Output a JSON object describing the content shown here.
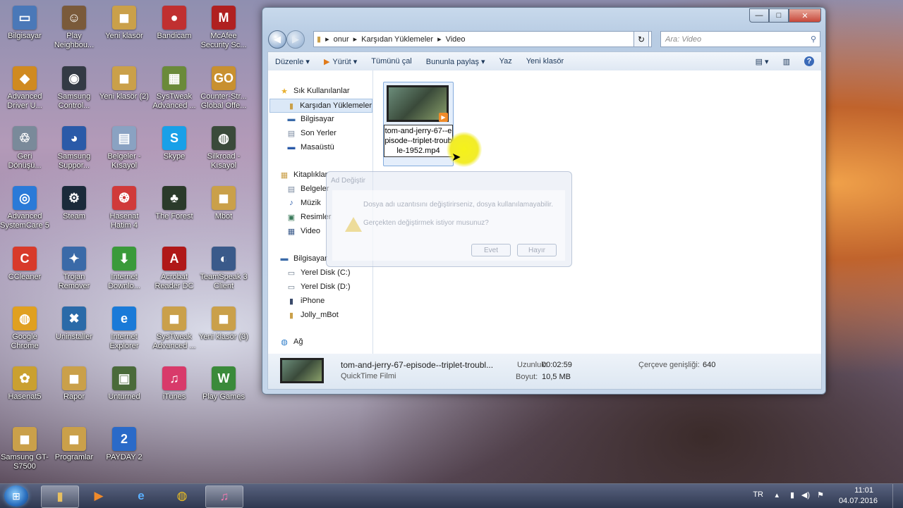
{
  "desktop": {
    "icons": [
      {
        "label": "Bilgisayar",
        "glyph": "▭",
        "color": "#4a78b8"
      },
      {
        "label": "Play Neighbou...",
        "glyph": "☺",
        "color": "#7a5a3a"
      },
      {
        "label": "Yeni klasör",
        "glyph": "◼",
        "color": "#caa04a"
      },
      {
        "label": "Bandicam",
        "glyph": "●",
        "color": "#c03030"
      },
      {
        "label": "McAfee Security Sc...",
        "glyph": "M",
        "color": "#b02020"
      },
      {
        "label": "Advanced Driver U...",
        "glyph": "◆",
        "color": "#d08a20"
      },
      {
        "label": "Samsung Control...",
        "glyph": "◉",
        "color": "#333a44"
      },
      {
        "label": "Yeni klasör (2)",
        "glyph": "◼",
        "color": "#caa04a"
      },
      {
        "label": "SysTweak Advanced ...",
        "glyph": "▦",
        "color": "#6a8a3a"
      },
      {
        "label": "Counter-Str... Global Offe...",
        "glyph": "GO",
        "color": "#c89030"
      },
      {
        "label": "Geri Dönüşü...",
        "glyph": "♲",
        "color": "#7a8a9a"
      },
      {
        "label": "Samsung Suppor...",
        "glyph": "◕",
        "color": "#2a5aa8"
      },
      {
        "label": "Belgeler - Kısayol",
        "glyph": "▤",
        "color": "#8aa2c2"
      },
      {
        "label": "Skype",
        "glyph": "S",
        "color": "#18a0e8"
      },
      {
        "label": "Silkroad - Kısayol",
        "glyph": "◍",
        "color": "#3a4a3a"
      },
      {
        "label": "Advanced SystemCare 5",
        "glyph": "◎",
        "color": "#2a7ad8"
      },
      {
        "label": "Steam",
        "glyph": "⚙",
        "color": "#1a2a3a"
      },
      {
        "label": "Hasenat Hatim 4",
        "glyph": "❂",
        "color": "#d03a3a"
      },
      {
        "label": "The Forest",
        "glyph": "♣",
        "color": "#2a3a2a"
      },
      {
        "label": "Mbot",
        "glyph": "◼",
        "color": "#caa04a"
      },
      {
        "label": "CCleaner",
        "glyph": "C",
        "color": "#d83a2a"
      },
      {
        "label": "Trojan Remover",
        "glyph": "✦",
        "color": "#3a6aa8"
      },
      {
        "label": "Internet Downlo...",
        "glyph": "⬇",
        "color": "#3a9a3a"
      },
      {
        "label": "Acrobat Reader DC",
        "glyph": "A",
        "color": "#b01818"
      },
      {
        "label": "TeamSpeak 3 Client",
        "glyph": "◐",
        "color": "#3a5a8a"
      },
      {
        "label": "Google Chrome",
        "glyph": "◍",
        "color": "#e0a020"
      },
      {
        "label": "Uninstaller",
        "glyph": "✖",
        "color": "#2a6aa8"
      },
      {
        "label": "Internet Explorer",
        "glyph": "e",
        "color": "#1a7ad8"
      },
      {
        "label": "SysTweak Advanced ...",
        "glyph": "◼",
        "color": "#caa04a"
      },
      {
        "label": "Yeni klasör (3)",
        "glyph": "◼",
        "color": "#caa04a"
      },
      {
        "label": "Hasenat5",
        "glyph": "✿",
        "color": "#caa030"
      },
      {
        "label": "Rapor",
        "glyph": "◼",
        "color": "#caa04a"
      },
      {
        "label": "Unturned",
        "glyph": "▣",
        "color": "#4a6a3a"
      },
      {
        "label": "iTunes",
        "glyph": "♫",
        "color": "#d83a6a"
      },
      {
        "label": "Play Games",
        "glyph": "W",
        "color": "#3a8a3a"
      },
      {
        "label": "Samsung GT-S7500",
        "glyph": "◼",
        "color": "#caa04a"
      },
      {
        "label": "Programlar",
        "glyph": "◼",
        "color": "#caa04a"
      },
      {
        "label": "PAYDAY 2",
        "glyph": "2",
        "color": "#2a6ac8"
      }
    ]
  },
  "window": {
    "caption_buttons": {
      "minimize": "—",
      "maximize": "□",
      "close": "✕"
    },
    "breadcrumb": [
      "onur",
      "Karşıdan Yüklemeler",
      "Video"
    ],
    "search_placeholder": "Ara: Video",
    "toolbar": [
      "Düzenle ▾",
      "Yürüt ▾",
      "Tümünü çal",
      "Bununla paylaş ▾",
      "Yaz",
      "Yeni klasör"
    ],
    "nav": {
      "favorites_header": "Sık Kullanılanlar",
      "favorites": [
        "Karşıdan Yüklemeler",
        "Bilgisayar",
        "Son Yerler",
        "Masaüstü"
      ],
      "libraries_header": "Kitaplıklar",
      "libraries": [
        "Belgeler",
        "Müzik",
        "Resimler",
        "Video"
      ],
      "computer_header": "Bilgisayar",
      "drives": [
        "Yerel Disk (C:)",
        "Yerel Disk (D:)",
        "iPhone",
        "Jolly_mBot"
      ],
      "network": "Ağ"
    },
    "file": {
      "name": "tom-and-jerry-67--episode--triplet-trouble-1952.mp4"
    },
    "details": {
      "title": "tom-and-jerry-67-episode--triplet-troubl...",
      "type": "QuickTime Filmi",
      "duration_label": "Uzunluk:",
      "duration": "00:02:59",
      "size_label": "Boyut:",
      "size": "10,5 MB",
      "frame_width_label": "Çerçeve genişliği:",
      "frame_width": "640"
    }
  },
  "dialog": {
    "title": "Ad Değiştir",
    "message": "Dosya adı uzantısını değiştirirseniz, dosya kullanılamayabilir.",
    "question": "Gerçekten değiştirmek istiyor musunuz?",
    "yes": "Evet",
    "no": "Hayır"
  },
  "taskbar": {
    "language": "TR",
    "time": "11:01",
    "date": "04.07.2016"
  }
}
